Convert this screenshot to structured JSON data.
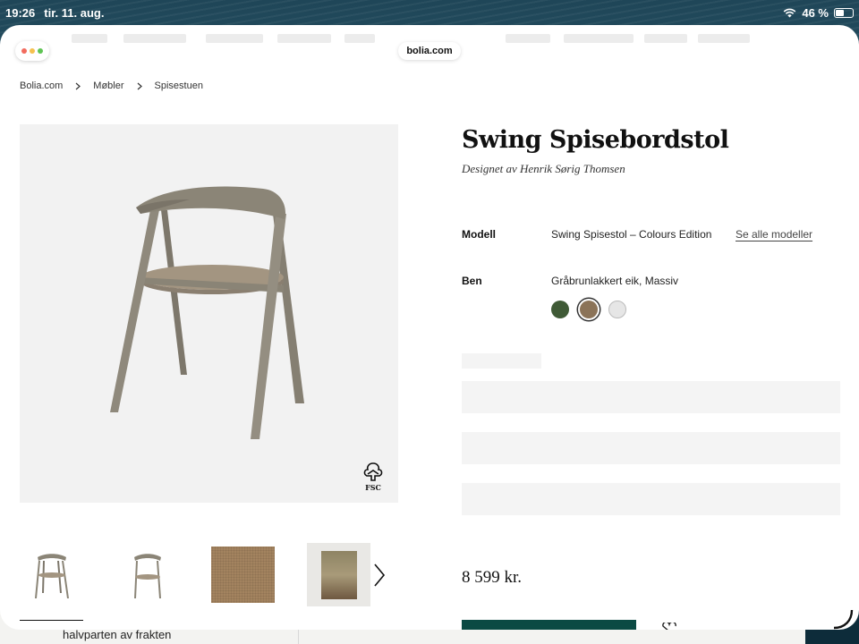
{
  "status_bar": {
    "time": "19:26",
    "date": "tir. 11. aug.",
    "battery": "46 %"
  },
  "browser": {
    "url": "bolia.com"
  },
  "breadcrumb": [
    "Bolia.com",
    "Møbler",
    "Spisestuen"
  ],
  "product": {
    "title": "Swing Spisebordstol",
    "designer": "Designet av Henrik Sørig Thomsen",
    "model_label": "Modell",
    "model_value": "Swing Spisestol – Colours Edition",
    "model_link": "Se alle modeller",
    "legs_label": "Ben",
    "legs_value": "Gråbrunlakkert eik, Massiv",
    "price": "8 599 kr."
  },
  "swatches": [
    {
      "name": "dark-green",
      "color": "#3f5a36",
      "selected": false
    },
    {
      "name": "grey-brown",
      "color": "#8b7358",
      "selected": true
    },
    {
      "name": "light-grey",
      "color": "#e6e6e6",
      "selected": false
    }
  ],
  "thumbnails": [
    "chair-front",
    "chair-side",
    "fabric",
    "room-scene"
  ],
  "fsc_label": "FSC",
  "under_page": {
    "promo": "halvparten av frakten"
  },
  "colors": {
    "accent": "#0b4a43",
    "image_bg": "#f2f2f2",
    "chair": "#8a8476"
  }
}
